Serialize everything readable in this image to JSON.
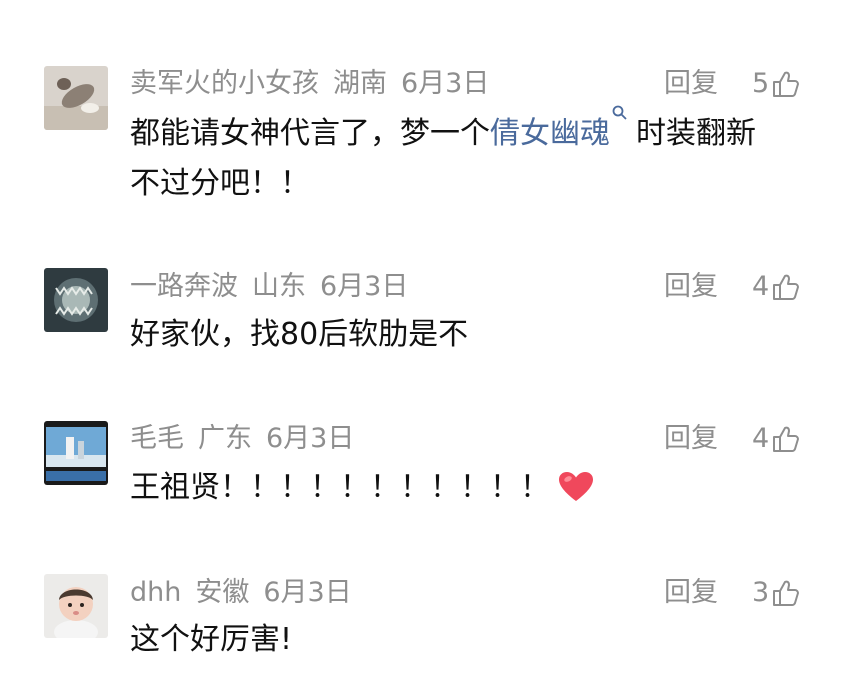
{
  "comments": [
    {
      "name": "卖军火的小女孩",
      "region": "湖南",
      "date": "6月3日",
      "reply": "回复",
      "likes": "5",
      "text_pre": "都能请女神代言了，梦一个",
      "link": "倩女幽魂",
      "text_post": "时装翻新",
      "text_line2": "不过分吧！！"
    },
    {
      "name": "一路奔波",
      "region": "山东",
      "date": "6月3日",
      "reply": "回复",
      "likes": "4",
      "text": "好家伙，找80后软肋是不"
    },
    {
      "name": "毛毛",
      "region": "广东",
      "date": "6月3日",
      "reply": "回复",
      "likes": "4",
      "text": "王祖贤！！！！！！！！！！！"
    },
    {
      "name": "dhh",
      "region": "安徽",
      "date": "6月3日",
      "reply": "回复",
      "likes": "3",
      "text": "这个好厉害!"
    }
  ],
  "icons": {
    "like": "thumbs-up-icon",
    "search": "search-icon",
    "heart": "heart-emoji-icon"
  },
  "colors": {
    "meta": "#8e8e8e",
    "link": "#4a6a9c",
    "heart": "#f0485c"
  }
}
